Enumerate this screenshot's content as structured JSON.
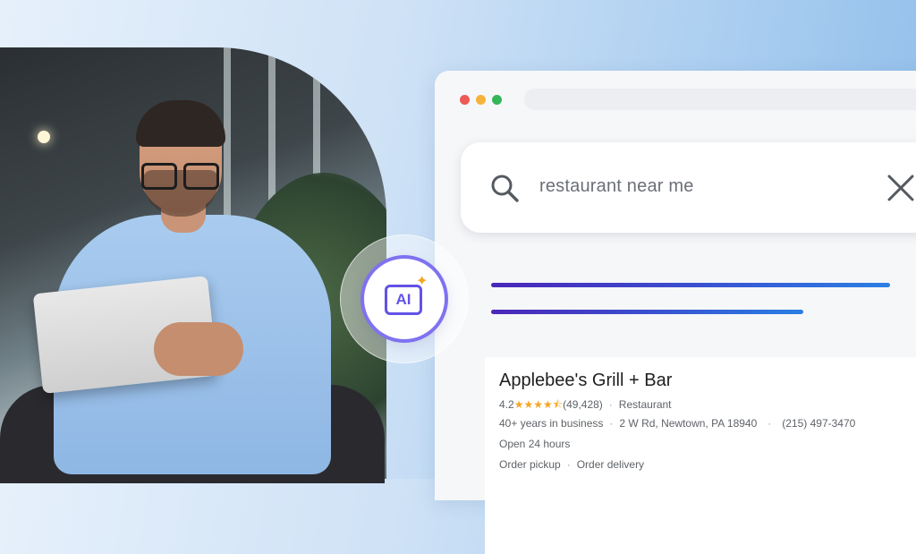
{
  "colors": {
    "accent_purple": "#6352e6",
    "bar_gradient_start": "#4a27b8",
    "bar_gradient_end": "#2b7fe3",
    "star": "#f5a623",
    "dot_red": "#ec5b56",
    "dot_yellow": "#f6b33c",
    "dot_green": "#34b55a"
  },
  "ai_badge": {
    "label": "AI",
    "icon": "sparkle-icon"
  },
  "search": {
    "query": "restaurant near me",
    "search_icon": "search-icon",
    "clear_icon": "close-icon"
  },
  "result": {
    "name": "Applebee's Grill + Bar",
    "rating": "4.2",
    "rating_value": 4.2,
    "stars": "★★★★⯪",
    "review_count": "(49,428)",
    "category": "Restaurant",
    "years": "40+ years in business",
    "address": "2 W Rd, Newtown, PA 18940",
    "phone": "(215) 497-3470",
    "hours": "Open 24 hours",
    "actions": [
      "Order pickup",
      "Order delivery"
    ]
  }
}
